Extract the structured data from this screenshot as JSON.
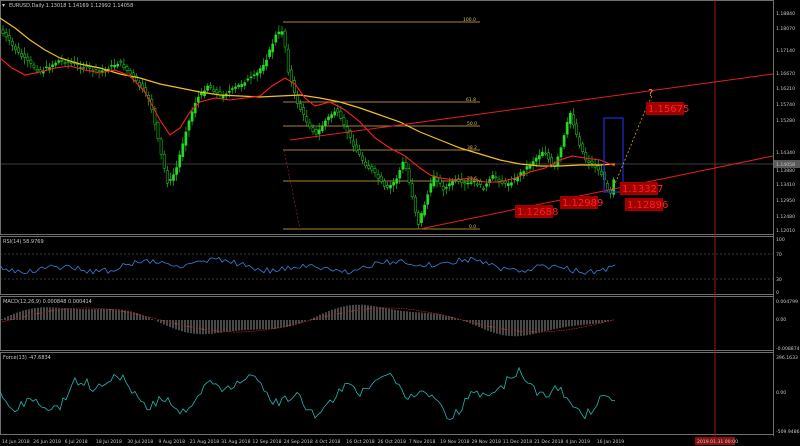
{
  "header": {
    "symbol_icon": "dropdown-triangle-icon",
    "title": "EURUSD,Daily  1.13018 1.14169 1.12992 1.14058"
  },
  "indicators": {
    "rsi": {
      "title": "RSI(14) 58.9769",
      "levels": [
        "70",
        "30"
      ],
      "scale_high": "100",
      "scale_low": "0"
    },
    "macd": {
      "title": "MACD(12,26,9) 0.000848 0.000414",
      "scale_top": "0.004799",
      "scale_mid": "0.00",
      "scale_bottom": "-0.008874"
    },
    "force": {
      "title": "Force(13) -47.6834",
      "scale_top": "396.1633",
      "scale_mid": "0.00",
      "scale_bottom": "-509.9486"
    }
  },
  "price_scale": [
    "1.18840",
    "1.18070",
    "1.17140",
    "1.16670",
    "1.16210",
    "1.15740",
    "1.15280",
    "1.14340",
    "1.13880",
    "1.13410",
    "1.12950",
    "1.12480",
    "1.12010"
  ],
  "current_price": "1.14058",
  "date_axis": [
    "14 Jun 2018",
    "26 Jun 2018",
    "6 Jul 2018",
    "18 Jul 2018",
    "30 Jul 2018",
    "9 Aug 2018",
    "21 Aug 2018",
    "31 Aug 2018",
    "12 Sep 2018",
    "24 Sep 2018",
    "4 Oct 2018",
    "16 Oct 2018",
    "26 Oct 2018",
    "7 Nov 2018",
    "19 Nov 2018",
    "29 Nov 2018",
    "11 Dec 2018",
    "21 Dec 2018",
    "4 Jan 2019",
    "16 Jan 2019"
  ],
  "vline_date_label": "2019.01.31 00:00",
  "fib_levels": [
    "100.0",
    "61.8",
    "50.0",
    "38.2",
    "23.6",
    "0.0"
  ],
  "annotations": {
    "question_mark": "?",
    "price_labels": [
      "1.15675",
      "1.13327",
      "1.12688",
      "1.12989",
      "1.12896"
    ]
  },
  "colors": {
    "background": "#000000",
    "bull_candle": "#22dd22",
    "bear_candle": "#000000",
    "ma_fast": "#ff2020",
    "ma_slow": "#f0c020",
    "trendline": "#e02020",
    "fib": "#d8b040",
    "rsi": "#3a7fd8",
    "force": "#20b8b0",
    "annotation_box": "#2030d0"
  }
}
